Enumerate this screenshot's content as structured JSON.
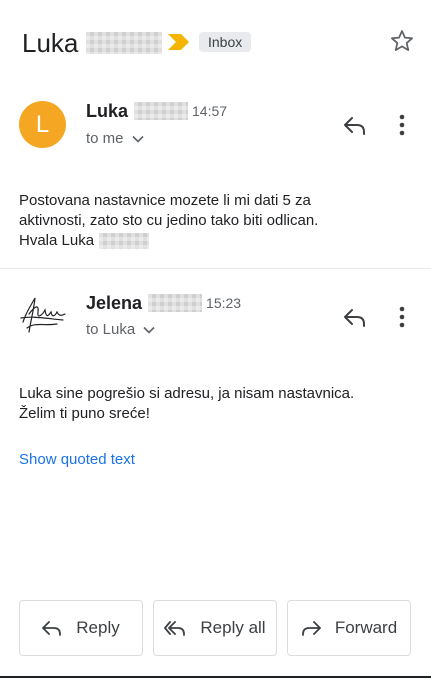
{
  "subject": {
    "sender_first": "Luka",
    "label": "Inbox"
  },
  "messages": [
    {
      "avatar_letter": "L",
      "sender": "Luka",
      "time": "14:57",
      "recipient": "to me",
      "body_lines": [
        "Postovana nastavnice mozete li mi dati 5 za",
        "aktivnosti, zato sto cu jedino tako biti odlican.",
        "Hvala Luka"
      ]
    },
    {
      "sender": "Jelena",
      "time": "15:23",
      "recipient": "to Luka",
      "body_lines": [
        "Luka sine pogrešio si adresu, ja nisam nastavnica.",
        "Želim ti puno sreće!"
      ],
      "show_quoted": "Show quoted text"
    }
  ],
  "actions": {
    "reply": "Reply",
    "reply_all": "Reply all",
    "forward": "Forward"
  },
  "colors": {
    "avatar": "#f5a623",
    "label_arrow": "#f4b400",
    "link": "#1a73e8"
  }
}
